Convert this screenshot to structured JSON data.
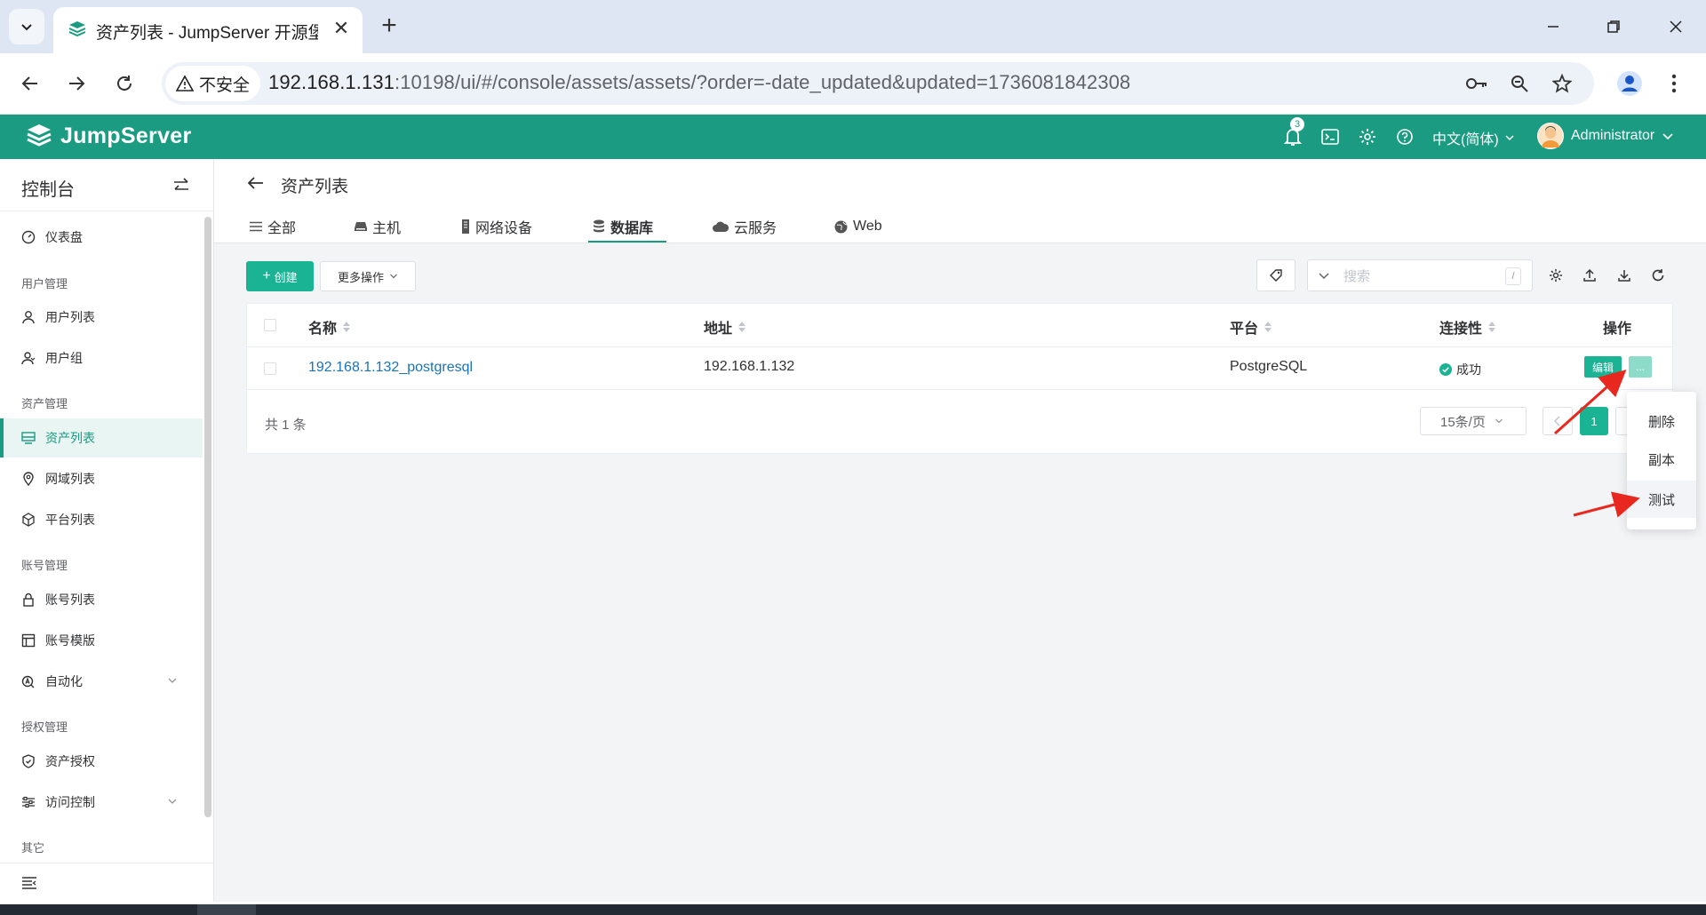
{
  "browser": {
    "tab_title": "资产列表 - JumpServer 开源堡垒机",
    "security_label": "不安全",
    "url_host": "192.168.1.131",
    "url_rest": ":10198/ui/#/console/assets/assets/?order=-date_updated&updated=1736081842308"
  },
  "header": {
    "logo_text": "JumpServer",
    "notification_count": "3",
    "language": "中文(简体)",
    "user_name": "Administrator"
  },
  "sidebar": {
    "title": "控制台",
    "dashboard": "仪表盘",
    "groups": {
      "user_mgmt": "用户管理",
      "asset_mgmt": "资产管理",
      "account_mgmt": "账号管理",
      "perm_mgmt": "授权管理",
      "other": "其它"
    },
    "items": {
      "user_list": "用户列表",
      "user_group": "用户组",
      "asset_list": "资产列表",
      "zone_list": "网域列表",
      "platform_list": "平台列表",
      "account_list": "账号列表",
      "account_template": "账号模版",
      "automation": "自动化",
      "asset_perm": "资产授权",
      "access_control": "访问控制"
    }
  },
  "page": {
    "title": "资产列表",
    "tabs": [
      "全部",
      "主机",
      "网络设备",
      "数据库",
      "云服务",
      "Web"
    ],
    "active_tab": "数据库",
    "create_label": "创建",
    "more_actions_label": "更多操作",
    "search_placeholder": "搜索",
    "search_shortcut": "/"
  },
  "table": {
    "columns": [
      "名称",
      "地址",
      "平台",
      "连接性",
      "操作"
    ],
    "rows": [
      {
        "name": "192.168.1.132_postgresql",
        "address": "192.168.1.132",
        "platform": "PostgreSQL",
        "connectivity": "成功",
        "edit_label": "编辑",
        "more_label": "..."
      }
    ]
  },
  "pagination": {
    "total": "共 1 条",
    "page_size": "15条/页",
    "current_page": "1"
  },
  "dropdown": {
    "items": [
      "删除",
      "副本",
      "测试"
    ],
    "highlighted": "测试"
  },
  "colors": {
    "brand": "#1a9b82",
    "primary_button": "#1ab394",
    "annotation_arrow": "#e8281e"
  }
}
